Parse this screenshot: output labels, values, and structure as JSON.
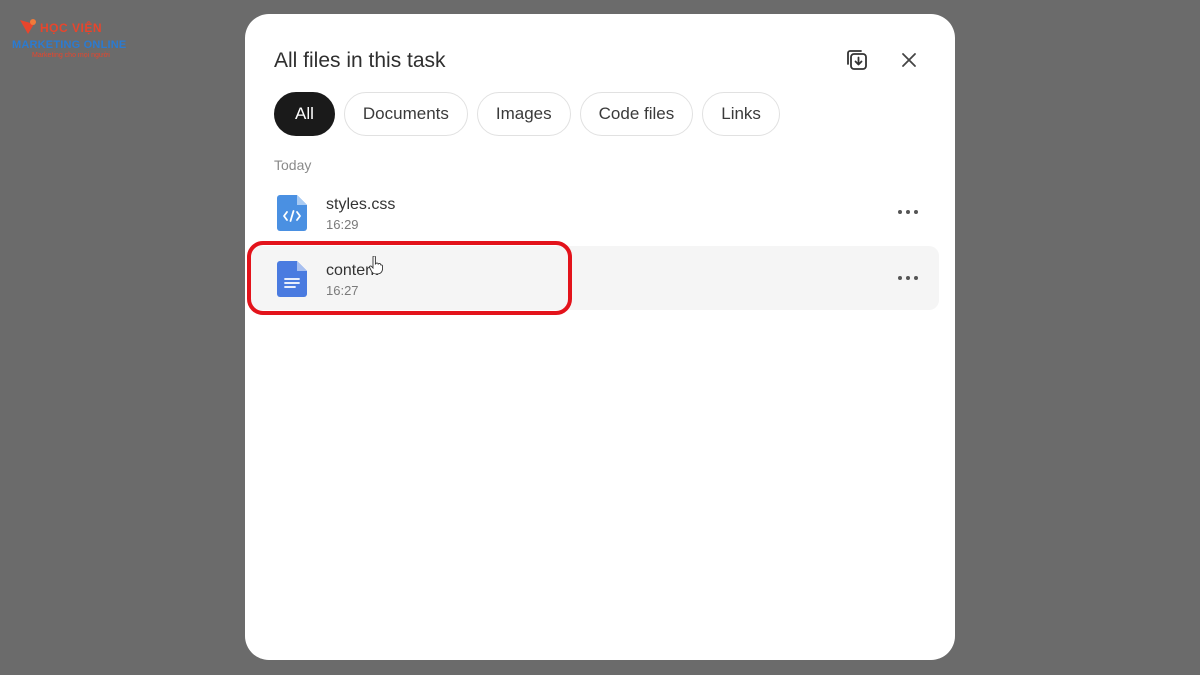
{
  "watermark": {
    "line1": "HỌC VIỆN",
    "line2": "MARKETING ONLINE",
    "line3": "Marketing cho mọi người"
  },
  "modal": {
    "title": "All files in this task",
    "download_icon": "download-all-icon",
    "close_icon": "close-icon"
  },
  "tabs": [
    {
      "label": "All",
      "active": true
    },
    {
      "label": "Documents",
      "active": false
    },
    {
      "label": "Images",
      "active": false
    },
    {
      "label": "Code files",
      "active": false
    },
    {
      "label": "Links",
      "active": false
    }
  ],
  "section": {
    "label": "Today"
  },
  "files": [
    {
      "name": "styles.css",
      "time": "16:29",
      "icon": "code-file-icon",
      "color": "#4a90e2"
    },
    {
      "name": "content",
      "time": "16:27",
      "icon": "document-file-icon",
      "color": "#4a7be0"
    }
  ],
  "colors": {
    "backdrop": "#6b6b6b",
    "highlight": "#e3131b",
    "active_tab": "#1a1a1a"
  }
}
